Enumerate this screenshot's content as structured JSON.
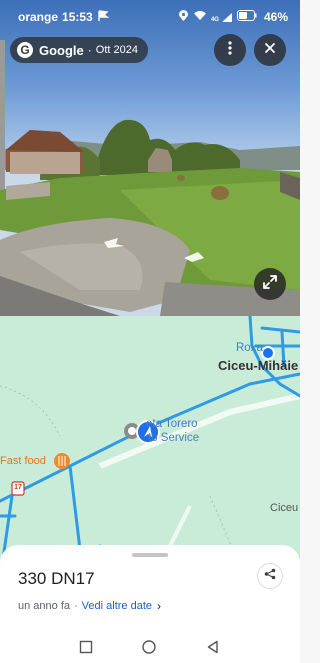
{
  "status_bar": {
    "carrier": "orange",
    "time": "15:53",
    "network": "4G",
    "battery": "46%",
    "icons": [
      "location-icon",
      "wifi-icon",
      "signal-icon",
      "battery-icon"
    ]
  },
  "street_view": {
    "brand": "Google",
    "separator": "·",
    "capture_date": "Ott 2024",
    "more_icon": "more-vertical-icon",
    "close_icon": "close-icon",
    "expand_icon": "expand-icon"
  },
  "map": {
    "labels": {
      "roxana": "Roxa",
      "ciceu_mihaiesti": "Ciceu-Mihăie",
      "torero_line1": "eta Torero",
      "torero_line2": "to Service",
      "fast_food": "Fast food",
      "ciceu_east": "Ciceu"
    },
    "road_shield": "17",
    "accent_road": "#2e9be6",
    "background": "#c9ecd8"
  },
  "place": {
    "title": "330 DN17",
    "age": "un anno fa",
    "separator": "·",
    "more_dates": "Vedi altre date",
    "chevron": "›"
  },
  "nav_bar": {
    "icons": [
      "recents-icon",
      "home-icon",
      "back-icon"
    ]
  }
}
